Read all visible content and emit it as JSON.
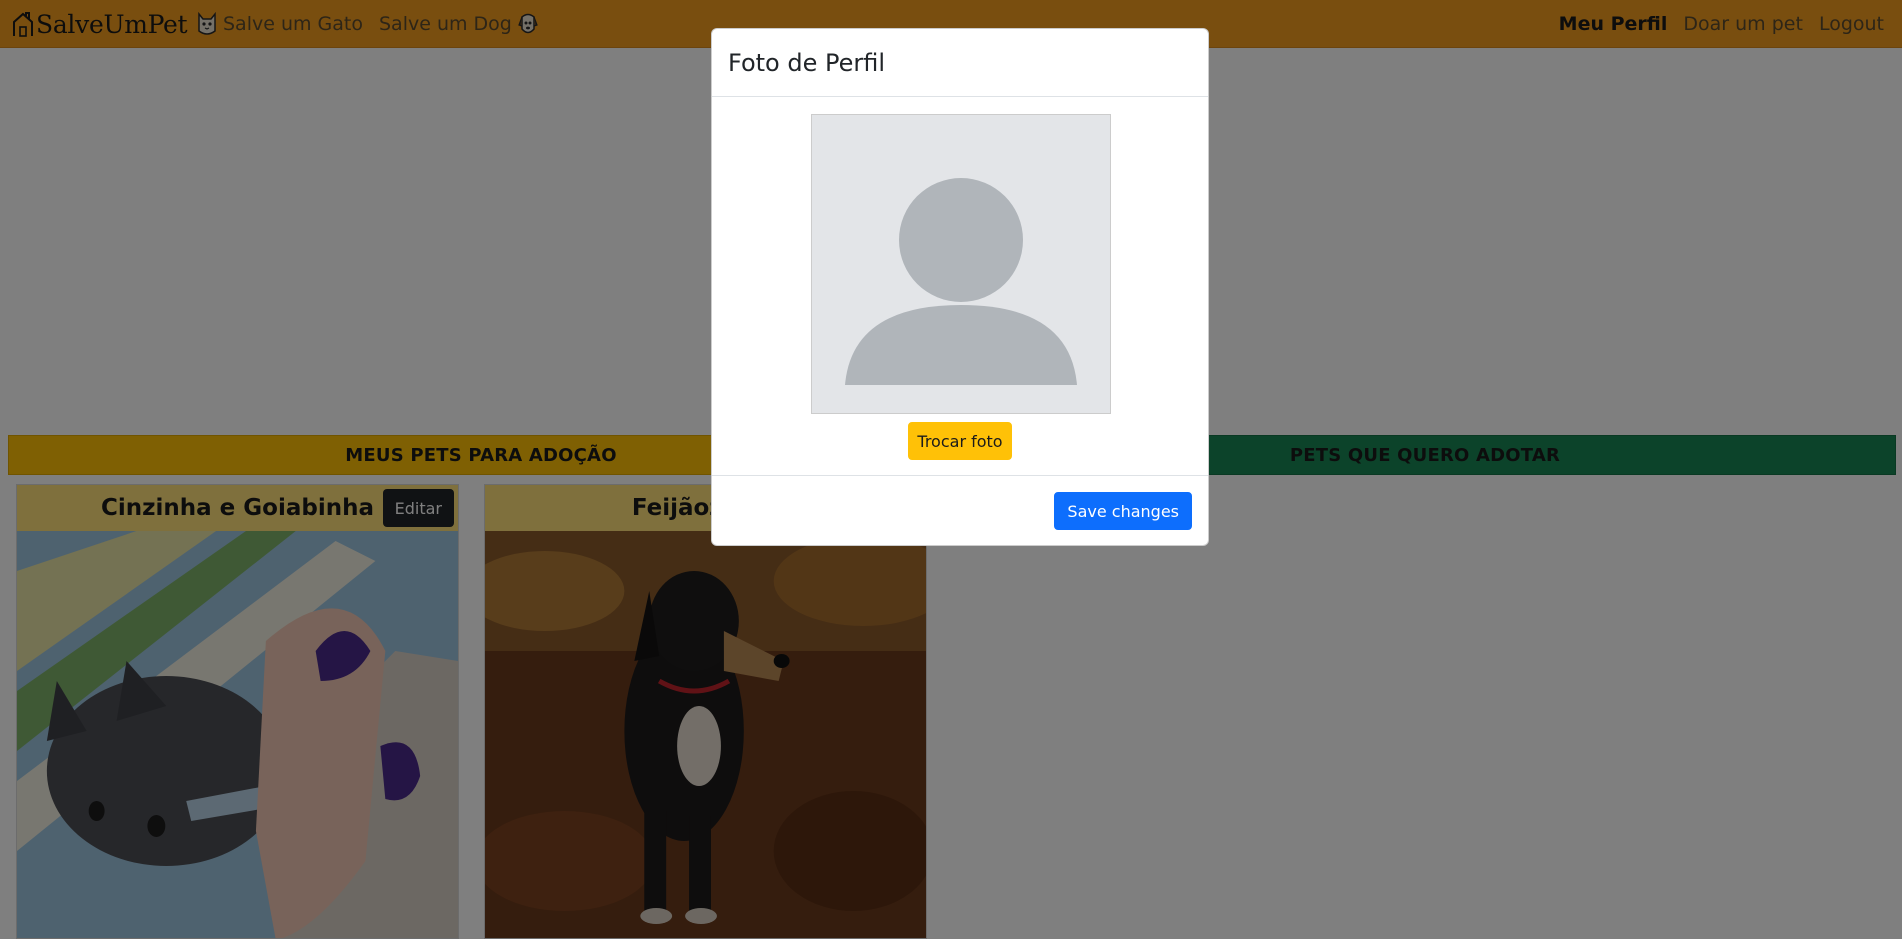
{
  "navbar": {
    "brand": "SalveUmPet",
    "left_links": [
      {
        "label": "Salve um Gato",
        "icon": "cat-icon"
      },
      {
        "label": "Salve um Dog",
        "icon": "dog-icon"
      }
    ],
    "right_links": [
      {
        "label": "Meu Perfil",
        "active": true
      },
      {
        "label": "Doar um pet",
        "active": false
      },
      {
        "label": "Logout",
        "active": false
      }
    ],
    "color": "#f39c1f"
  },
  "sections": {
    "my_pets_title": "MEUS PETS PARA ADOÇÃO",
    "wanted_pets_title": "PETS QUE QUERO ADOTAR"
  },
  "pets": [
    {
      "name": "Cinzinha e Goiabinha",
      "edit_label": "Editar",
      "photo": "kitten being bottle fed"
    },
    {
      "name": "Feijãozinho",
      "photo": "dog sitting on leaves"
    }
  ],
  "modal": {
    "title": "Foto de Perfil",
    "change_photo_label": "Trocar foto",
    "save_label": "Save changes",
    "avatar_icon": "default-user-avatar-icon"
  },
  "colors": {
    "yellow": "#ffc107",
    "green": "#198754",
    "primary": "#0d6efd"
  }
}
